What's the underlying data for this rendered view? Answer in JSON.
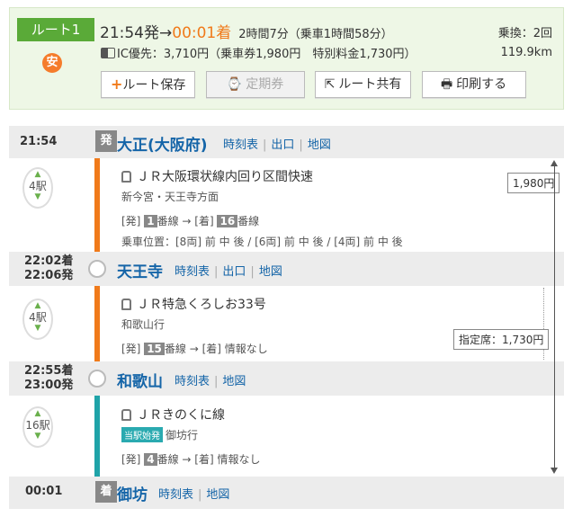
{
  "summary": {
    "route_label": "ルート1",
    "fare_icon": "安",
    "depart_time": "21:54発",
    "arrow": "→",
    "arrive_time": "00:01着",
    "duration": "2時間7分（乗車1時間58分）",
    "transfers": "乗換：2回",
    "fare": "IC優先：3,710円（乗車券1,980円　特別料金1,730円）",
    "distance": "119.9km",
    "buttons": {
      "save": "ルート保存",
      "pass": "定期券",
      "share": "ルート共有",
      "print": "印刷する"
    }
  },
  "links": {
    "timetable": "時刻表",
    "exit": "出口",
    "map": "地図"
  },
  "stations": [
    {
      "time": "21:54",
      "badge": "発",
      "name": "大正(大阪府)"
    },
    {
      "time_arr": "22:02着",
      "time_dep": "22:06発",
      "name": "天王寺"
    },
    {
      "time_arr": "22:55着",
      "time_dep": "23:00発",
      "name": "和歌山"
    },
    {
      "time": "00:01",
      "badge": "着",
      "name": "御坊"
    }
  ],
  "segments": [
    {
      "stops": "4駅",
      "train": "ＪＲ大阪環状線内回り区間快速",
      "direction": "新今宮・天王寺方面",
      "plat_dep_label": "[発]",
      "plat_dep": "1",
      "plat_unit": "番線",
      "plat_arr_label": "[着]",
      "plat_arr": "16",
      "plat_arr_unit": "番線",
      "car_pos": "乗車位置：[8両] 前 中 後 / [6両] 前 中 後 / [4両] 前 中 後"
    },
    {
      "stops": "4駅",
      "train": "ＪＲ特急くろしお33号",
      "direction": "和歌山行",
      "plat_dep_label": "[発]",
      "plat_dep": "15",
      "plat_unit": "番線",
      "plat_arr_text": "[着] 情報なし"
    },
    {
      "stops": "16駅",
      "train": "ＪＲきのくに線",
      "first_tag": "当駅始発",
      "direction": "御坊行",
      "plat_dep_label": "[発]",
      "plat_dep": "4",
      "plat_unit": "番線",
      "plat_arr_text": "[着] 情報なし"
    }
  ],
  "fares": {
    "ticket": "1,980円",
    "reserved": "指定席：1,730円"
  },
  "colors": {
    "orange_line": "#f07a1a",
    "teal_line": "#1fa3a8",
    "accent_green": "#5aaa38",
    "link_blue": "#1565a8"
  }
}
